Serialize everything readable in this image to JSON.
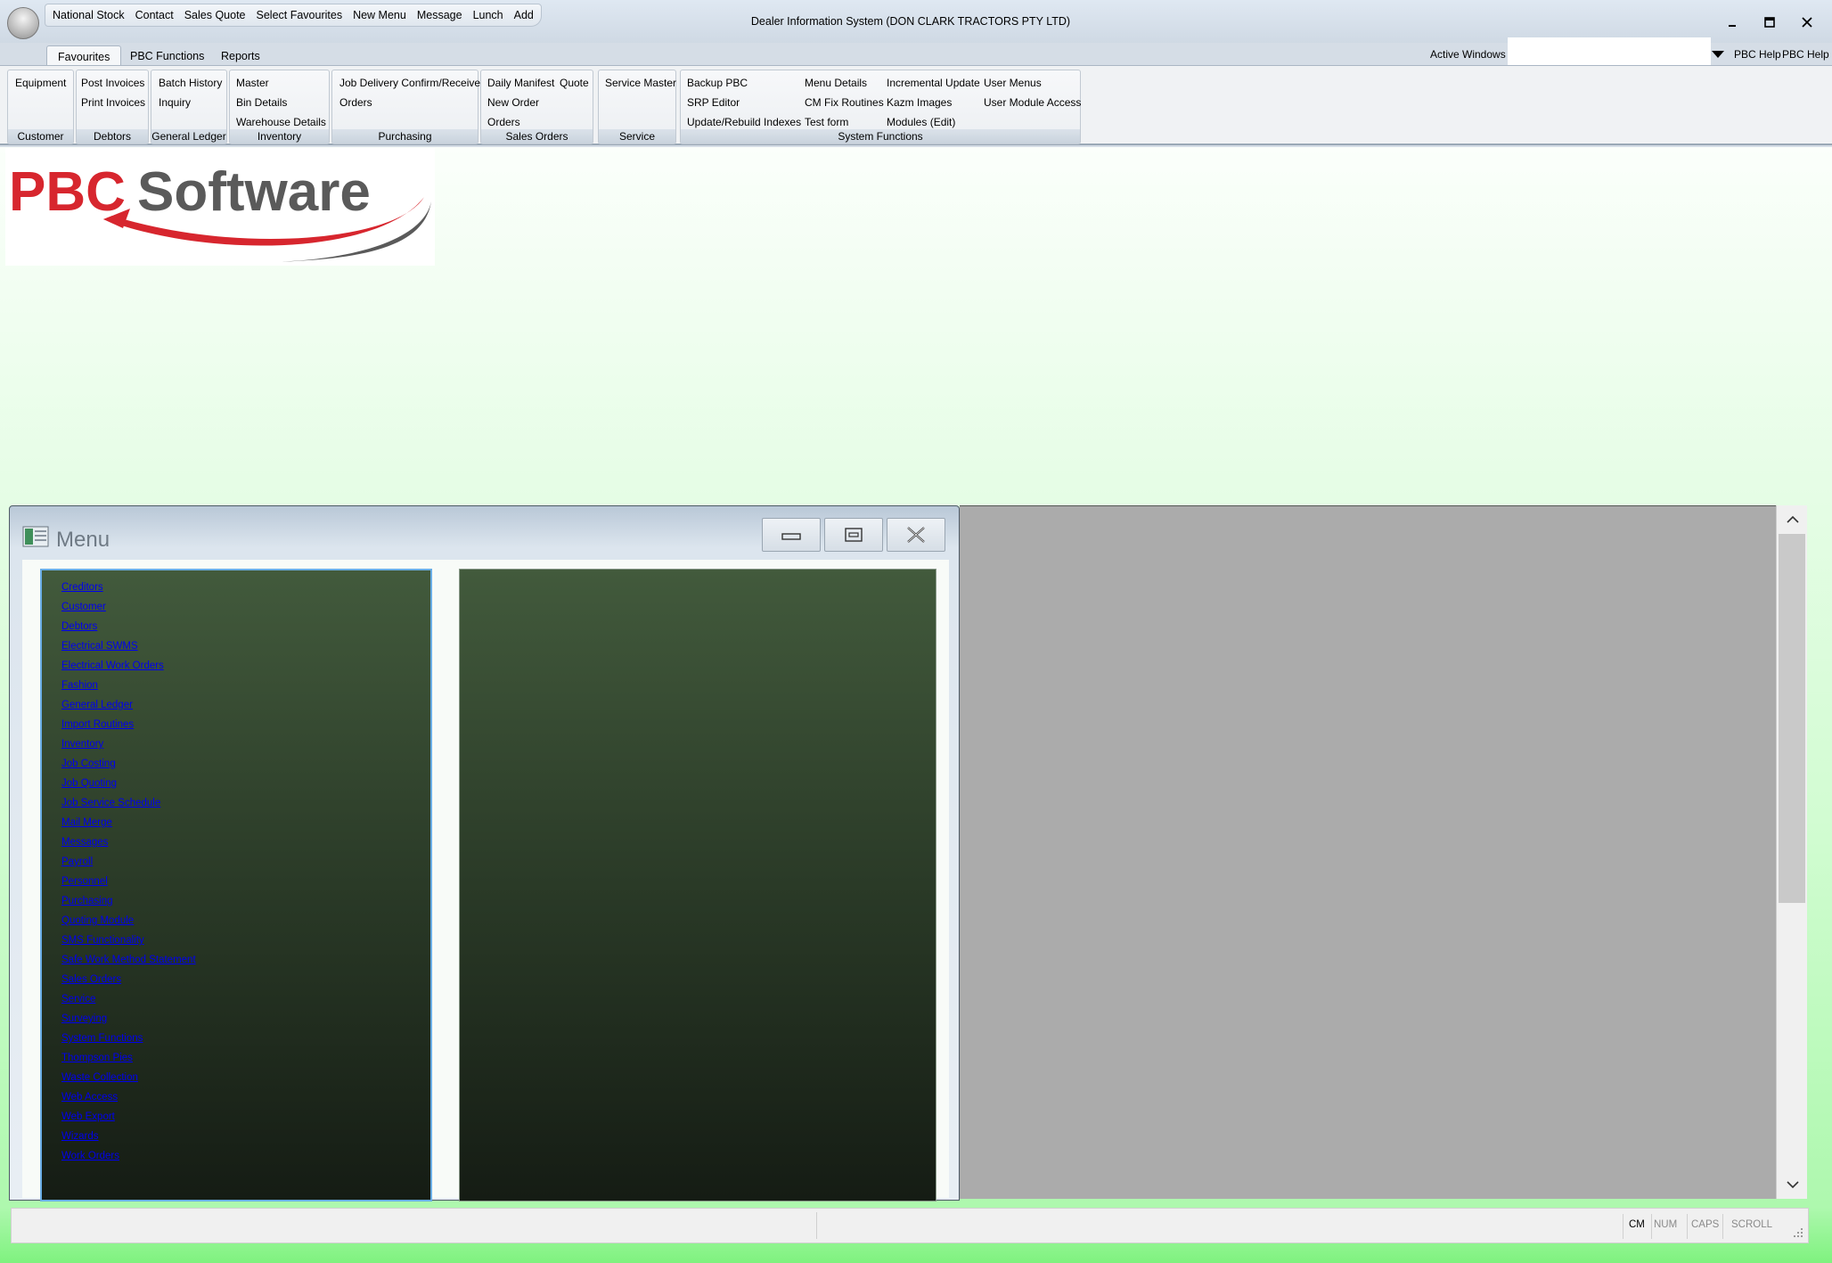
{
  "app": {
    "title": "Dealer Information System (DON CLARK TRACTORS PTY LTD)"
  },
  "quick_access": [
    "National Stock",
    "Contact",
    "Sales Quote",
    "Select Favourites",
    "New Menu",
    "Message",
    "Lunch",
    "Add"
  ],
  "tabs": [
    "Favourites",
    "PBC Functions",
    "Reports"
  ],
  "active_tab": "Favourites",
  "tabs_right": {
    "active_windows_label": "Active Windows",
    "help_1": "PBC Help",
    "help_2": "PBC Help"
  },
  "ribbon": {
    "customer": {
      "caption": "Customer",
      "items": [
        "Equipment"
      ]
    },
    "debtors": {
      "caption": "Debtors",
      "items": [
        "Post Invoices",
        "Print Invoices"
      ]
    },
    "general_ledger": {
      "caption": "General Ledger",
      "items": [
        "Batch History",
        "Inquiry"
      ]
    },
    "inventory": {
      "caption": "Inventory",
      "items": [
        "Master",
        "Bin Details",
        "Warehouse Details"
      ]
    },
    "purchasing": {
      "caption": "Purchasing",
      "items": [
        "Job Delivery Confirm/Receive",
        "Orders"
      ]
    },
    "sales_orders": {
      "caption": "Sales Orders",
      "items": [
        "Daily Manifest",
        "Quote",
        "New Order",
        "Orders"
      ]
    },
    "service": {
      "caption": "Service",
      "items": [
        "Service Master"
      ]
    },
    "system_functions": {
      "caption": "System Functions",
      "items": [
        "Backup PBC",
        "SRP Editor",
        "Update/Rebuild Indexes",
        "Menu Details",
        "CM Fix Routines",
        "Test form",
        "Incremental Update",
        "Kazm Images",
        "Modules (Edit)",
        "User Menus",
        "User Module Access"
      ]
    }
  },
  "logo": {
    "text_pbc": "PBC",
    "text_software": "Software",
    "pbc_color": "#d7262e",
    "software_color": "#5a5a5a"
  },
  "menu_window": {
    "title": "Menu",
    "items": [
      "Creditors",
      "Customer",
      "Debtors",
      "Electrical SWMS",
      "Electrical Work Orders",
      "Fashion",
      "General Ledger",
      "Import Routines",
      "Inventory",
      "Job Costing",
      "Job Quoting",
      "Job Service Schedule",
      "Mail Merge",
      "Messages",
      "Payroll",
      "Personnel",
      "Purchasing",
      "Quoting Module",
      "SMS Functionality",
      "Safe Work Method Statement",
      "Sales Orders",
      "Service",
      "Surveying",
      "System Functions",
      "Thompson Pies",
      "Waste Collection",
      "Web Access",
      "Web Export",
      "Wizards",
      "Work Orders"
    ]
  },
  "statusbar": {
    "indicators": [
      "CM",
      "NUM",
      "CAPS",
      "SCROLL"
    ],
    "active": [
      "CM"
    ]
  },
  "colors": {
    "link": "#0000ee",
    "panel_top": "#425a3c",
    "panel_bottom": "#151c14",
    "background_green": "#7ff27f"
  }
}
